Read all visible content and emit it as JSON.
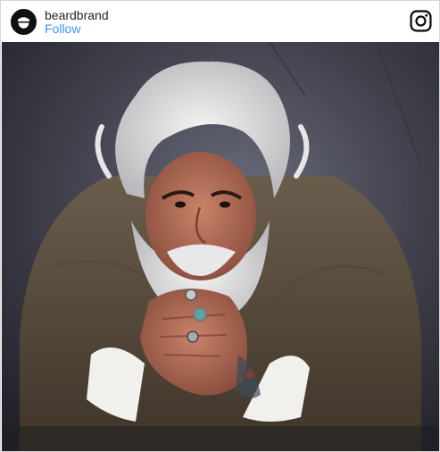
{
  "header": {
    "username": "beardbrand",
    "follow_label": "Follow",
    "avatar_icon": "beardbrand-logo-icon",
    "platform_icon": "instagram-icon"
  },
  "post": {
    "image_subject": "photo-portrait"
  },
  "colors": {
    "follow": "#3897f0",
    "username": "#262626",
    "backdrop": "#3f404c"
  }
}
